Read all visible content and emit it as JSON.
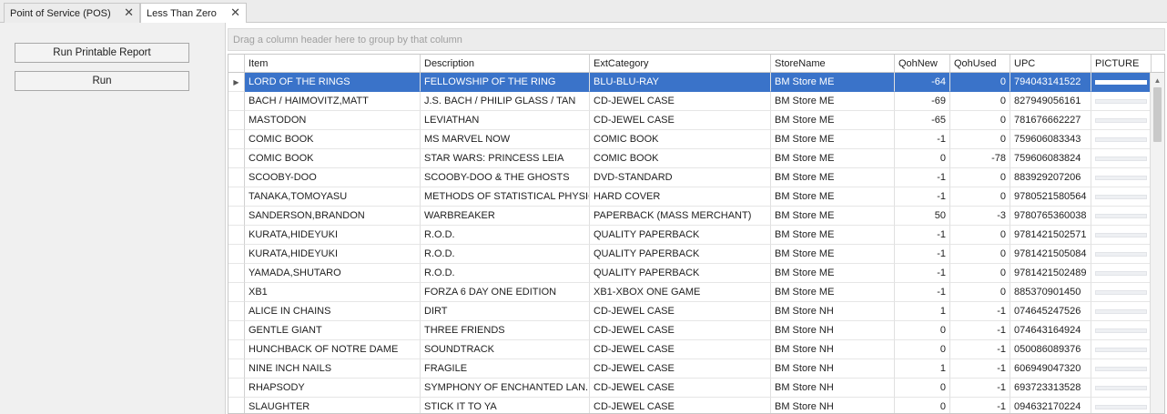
{
  "tabs": [
    {
      "label": "Point of Service (POS)",
      "active": false
    },
    {
      "label": "Less Than Zero",
      "active": true
    }
  ],
  "buttons": {
    "printable_report": "Run Printable Report",
    "run": "Run"
  },
  "grid": {
    "group_panel_hint": "Drag a column header here to group by that column",
    "columns": [
      "Item",
      "Description",
      "ExtCategory",
      "StoreName",
      "QohNew",
      "QohUsed",
      "UPC",
      "PICTURE"
    ],
    "selected_row": 0,
    "rows": [
      [
        "LORD OF THE RINGS",
        "FELLOWSHIP OF THE RING",
        "BLU-BLU-RAY",
        "BM Store ME",
        "-64",
        "0",
        "794043141522"
      ],
      [
        "BACH / HAIMOVITZ,MATT",
        "J.S. BACH / PHILIP GLASS / TAN",
        "CD-JEWEL CASE",
        "BM Store ME",
        "-69",
        "0",
        "827949056161"
      ],
      [
        "MASTODON",
        "LEVIATHAN",
        "CD-JEWEL CASE",
        "BM Store ME",
        "-65",
        "0",
        "781676662227"
      ],
      [
        "COMIC BOOK",
        "MS MARVEL NOW",
        "COMIC BOOK",
        "BM Store ME",
        "-1",
        "0",
        "759606083343"
      ],
      [
        "COMIC BOOK",
        "STAR WARS: PRINCESS LEIA",
        "COMIC BOOK",
        "BM Store ME",
        "0",
        "-78",
        "759606083824"
      ],
      [
        "SCOOBY-DOO",
        "SCOOBY-DOO & THE GHOSTS",
        "DVD-STANDARD",
        "BM Store ME",
        "-1",
        "0",
        "883929207206"
      ],
      [
        "TANAKA,TOMOYASU",
        "METHODS OF STATISTICAL PHYSICS",
        "HARD COVER",
        "BM Store ME",
        "-1",
        "0",
        "9780521580564"
      ],
      [
        "SANDERSON,BRANDON",
        "WARBREAKER",
        "PAPERBACK (MASS MERCHANT)",
        "BM Store ME",
        "50",
        "-3",
        "9780765360038"
      ],
      [
        "KURATA,HIDEYUKI",
        "R.O.D.",
        "QUALITY PAPERBACK",
        "BM Store ME",
        "-1",
        "0",
        "9781421502571"
      ],
      [
        "KURATA,HIDEYUKI",
        "R.O.D.",
        "QUALITY PAPERBACK",
        "BM Store ME",
        "-1",
        "0",
        "9781421505084"
      ],
      [
        "YAMADA,SHUTARO",
        "R.O.D.",
        "QUALITY PAPERBACK",
        "BM Store ME",
        "-1",
        "0",
        "9781421502489"
      ],
      [
        "XB1",
        "FORZA 6 DAY ONE EDITION",
        "XB1-XBOX ONE GAME",
        "BM Store ME",
        "-1",
        "0",
        "885370901450"
      ],
      [
        "ALICE IN CHAINS",
        "DIRT",
        "CD-JEWEL CASE",
        "BM Store NH",
        "1",
        "-1",
        "074645247526"
      ],
      [
        "GENTLE GIANT",
        "THREE FRIENDS",
        "CD-JEWEL CASE",
        "BM Store NH",
        "0",
        "-1",
        "074643164924"
      ],
      [
        "HUNCHBACK OF NOTRE DAME",
        "SOUNDTRACK",
        "CD-JEWEL CASE",
        "BM Store NH",
        "0",
        "-1",
        "050086089376"
      ],
      [
        "NINE INCH NAILS",
        "FRAGILE",
        "CD-JEWEL CASE",
        "BM Store NH",
        "1",
        "-1",
        "606949047320"
      ],
      [
        "RHAPSODY",
        "SYMPHONY OF ENCHANTED LAN...",
        "CD-JEWEL CASE",
        "BM Store NH",
        "0",
        "-1",
        "693723313528"
      ],
      [
        "SLAUGHTER",
        "STICK IT TO YA",
        "CD-JEWEL CASE",
        "BM Store NH",
        "0",
        "-1",
        "094632170224"
      ]
    ]
  }
}
